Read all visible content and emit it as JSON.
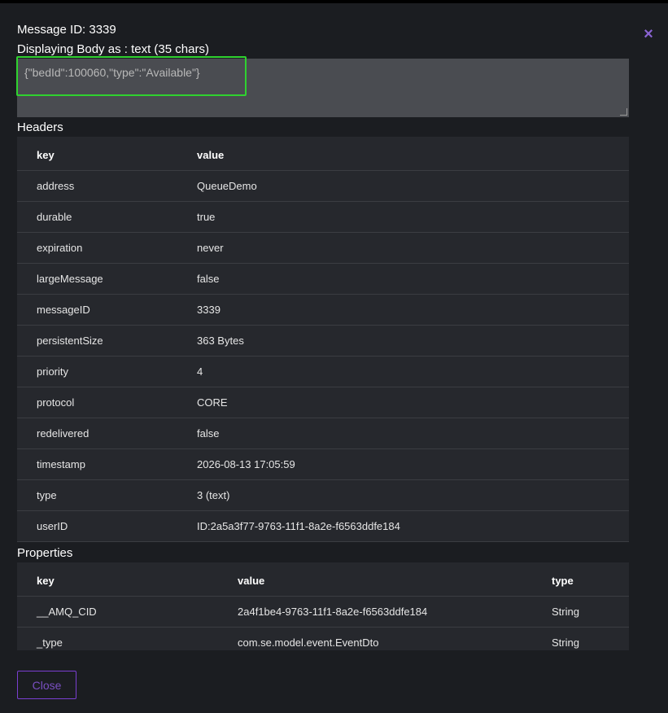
{
  "dialog": {
    "message_id_text": "Message ID: 3339",
    "body_info_text": "Displaying Body as : text (35 chars)",
    "body_content": "{\"bedId\":100060,\"type\":\"Available\"}",
    "close_x": "×",
    "close_button_label": "Close"
  },
  "headers": {
    "title": "Headers",
    "columns": [
      "key",
      "value"
    ],
    "rows": [
      {
        "key": "address",
        "value": "QueueDemo"
      },
      {
        "key": "durable",
        "value": "true"
      },
      {
        "key": "expiration",
        "value": "never"
      },
      {
        "key": "largeMessage",
        "value": "false"
      },
      {
        "key": "messageID",
        "value": "3339"
      },
      {
        "key": "persistentSize",
        "value": "363 Bytes"
      },
      {
        "key": "priority",
        "value": "4"
      },
      {
        "key": "protocol",
        "value": "CORE"
      },
      {
        "key": "redelivered",
        "value": "false"
      },
      {
        "key": "timestamp",
        "value": "2026-08-13 17:05:59"
      },
      {
        "key": "type",
        "value": "3 (text)"
      },
      {
        "key": "userID",
        "value": "ID:2a5a3f77-9763-11f1-8a2e-f6563ddfe184"
      }
    ]
  },
  "properties": {
    "title": "Properties",
    "columns": [
      "key",
      "value",
      "type"
    ],
    "rows": [
      {
        "key": "__AMQ_CID",
        "value": "2a4f1be4-9763-11f1-8a2e-f6563ddfe184",
        "type": "String"
      },
      {
        "key": "_type",
        "value": "com.se.model.event.EventDto",
        "type": "String"
      }
    ]
  },
  "colors": {
    "background": "#1b1d21",
    "table_bg": "#26282d",
    "accent_purple": "#8a63d2",
    "highlight_green": "#2fd22f"
  }
}
